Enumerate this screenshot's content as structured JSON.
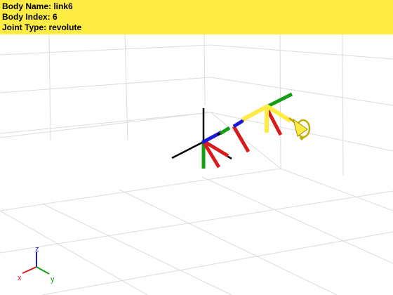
{
  "info": {
    "body_name": "Body Name: link6",
    "body_index": "Body Index: 6",
    "joint_type": "Joint Type: revolute"
  },
  "triad": {
    "x": "x",
    "y": "y",
    "z": "z"
  },
  "colors": {
    "highlight": "#ffec42",
    "x_axis": "#d81c1c",
    "y_axis": "#12a012",
    "z_axis": "#1a1ad8",
    "grid": "#dcdcdc",
    "base": "#000000"
  }
}
